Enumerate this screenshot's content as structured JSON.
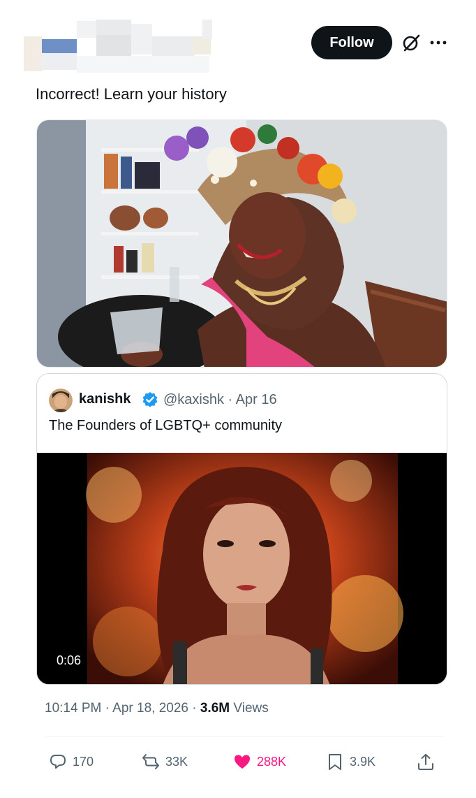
{
  "header": {
    "follow_label": "Follow",
    "grok_icon": "grok-slash-icon",
    "more_icon": "more-dots-icon"
  },
  "tweet": {
    "text": "Incorrect! Learn your history",
    "photo_icon": "photo-image"
  },
  "quote": {
    "name": "kanishk",
    "verified_icon": "verified-badge-icon",
    "handle_date": "@kaxishk · Apr 16",
    "text": "The Founders of LGBTQ+ community",
    "video_duration": "0:06"
  },
  "meta": {
    "time_date": "10:14 PM · Apr 18, 2026 · ",
    "views_count": "3.6M",
    "views_label": " Views"
  },
  "actions": {
    "replies": "170",
    "reposts": "33K",
    "likes": "288K",
    "bookmarks": "3.9K"
  },
  "colors": {
    "follow_bg": "#0f1419",
    "like": "#f91880",
    "muted": "#536471",
    "verified": "#1d9bf0"
  }
}
